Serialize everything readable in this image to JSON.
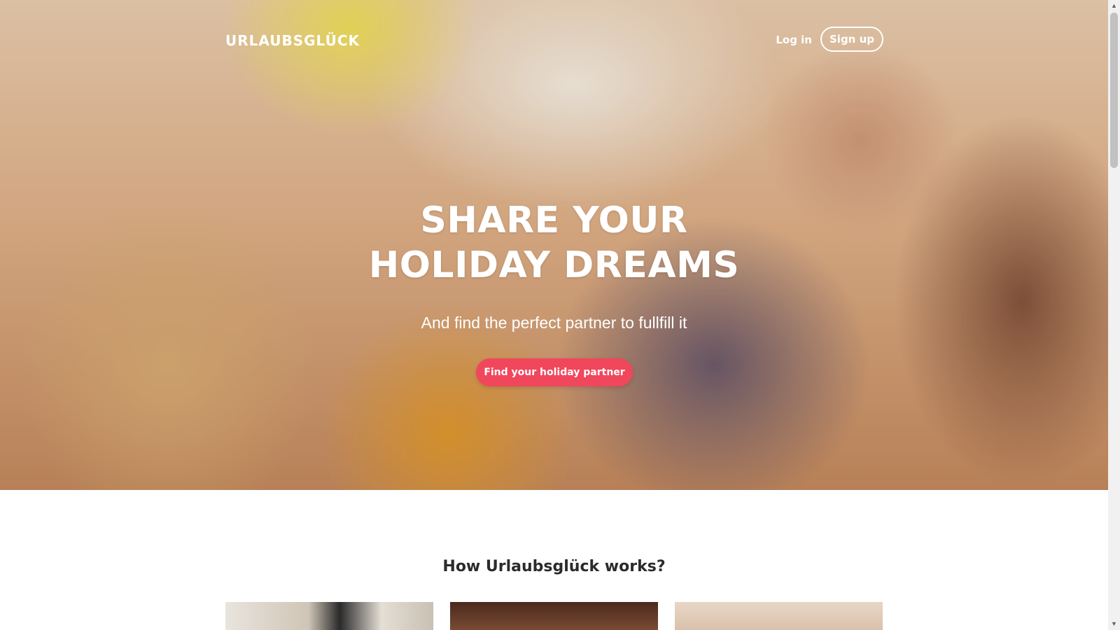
{
  "navbar": {
    "brand": "URLAUBSGLÜCK",
    "login_label": "Log in",
    "signup_label": "Sign up"
  },
  "hero": {
    "title_line1": "SHARE YOUR",
    "title_line2": "HOLIDAY DREAMS",
    "subtitle": "And find the perfect partner to fullfill it",
    "cta_label": "Find your holiday partner"
  },
  "how_it_works": {
    "title": "How Urlaubsglück works?"
  },
  "colors": {
    "accent": "#f0475c",
    "text_dark": "#2b2b2b",
    "white": "#ffffff"
  },
  "scrollbar": {
    "up_icon": "▲",
    "down_icon": "▼"
  }
}
